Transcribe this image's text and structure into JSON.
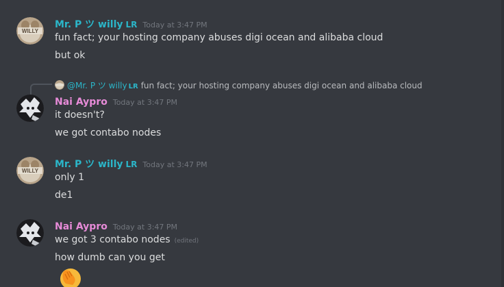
{
  "colors": {
    "background": "#36393f",
    "text": "#dcddde",
    "muted": "#72767d",
    "willy_name": "#2bb6c9",
    "nai_name": "#e78bd8"
  },
  "messages": [
    {
      "author": "Mr. P ツ willy",
      "author_tag": "LR",
      "timestamp": "Today at 3:47 PM",
      "avatar": "willy-avatar",
      "lines": [
        "fun fact; your hosting company abuses digi ocean and alibaba cloud",
        "but ok"
      ]
    },
    {
      "reply": {
        "author": "@Mr. P ツ willy",
        "author_tag": "LR",
        "text": "fun fact; your hosting company abuses digi ocean and alibaba cloud"
      },
      "author": "Nai Aypro",
      "timestamp": "Today at 3:47 PM",
      "avatar": "nai-avatar",
      "lines": [
        "it doesn't?",
        "we got contabo nodes"
      ]
    },
    {
      "author": "Mr. P ツ willy",
      "author_tag": "LR",
      "timestamp": "Today at 3:47 PM",
      "avatar": "willy-avatar",
      "lines": [
        "only 1",
        "de1"
      ]
    },
    {
      "author": "Nai Aypro",
      "timestamp": "Today at 3:47 PM",
      "avatar": "nai-avatar",
      "lines": [
        "we got 3 contabo nodes",
        "how dumb can you get"
      ],
      "edited_label": "(edited)",
      "emoji": "facepalm-emoji"
    }
  ]
}
